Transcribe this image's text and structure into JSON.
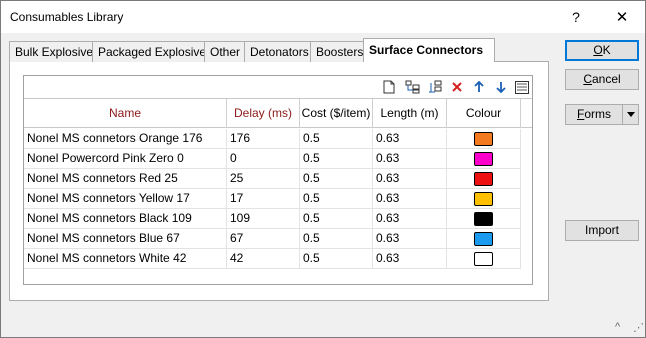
{
  "window": {
    "title": "Consumables Library",
    "help_label": "?",
    "close_label": "✕"
  },
  "tabs": [
    {
      "label": "Bulk Explosives",
      "active": false
    },
    {
      "label": "Packaged Explosives",
      "active": false
    },
    {
      "label": "Other",
      "active": false
    },
    {
      "label": "Detonators",
      "active": false
    },
    {
      "label": "Boosters",
      "active": false
    },
    {
      "label": "Surface Connectors",
      "active": true
    }
  ],
  "toolbar": {
    "icons": [
      "new-icon",
      "insert-row-icon",
      "append-row-icon",
      "delete-icon",
      "move-up-icon",
      "move-down-icon",
      "list-view-icon"
    ]
  },
  "table": {
    "columns": [
      "Name",
      "Delay (ms)",
      "Cost ($/item)",
      "Length (m)",
      "Colour"
    ],
    "rows": [
      {
        "name": "Nonel MS connetors Orange 176",
        "delay": "176",
        "cost": "0.5",
        "length": "0.63",
        "colour": "#f47a20"
      },
      {
        "name": "Nonel Powercord Pink Zero 0",
        "delay": "0",
        "cost": "0.5",
        "length": "0.63",
        "colour": "#ff00cc"
      },
      {
        "name": "Nonel MS connetors Red 25",
        "delay": "25",
        "cost": "0.5",
        "length": "0.63",
        "colour": "#ee1111"
      },
      {
        "name": "Nonel MS connetors Yellow 17",
        "delay": "17",
        "cost": "0.5",
        "length": "0.63",
        "colour": "#ffc000"
      },
      {
        "name": "Nonel MS connetors Black 109",
        "delay": "109",
        "cost": "0.5",
        "length": "0.63",
        "colour": "#000000"
      },
      {
        "name": "Nonel MS connetors Blue 67",
        "delay": "67",
        "cost": "0.5",
        "length": "0.63",
        "colour": "#1a9bef"
      },
      {
        "name": "Nonel MS connetors White 42",
        "delay": "42",
        "cost": "0.5",
        "length": "0.63",
        "colour": "#ffffff"
      }
    ]
  },
  "buttons": {
    "ok_underlined": "O",
    "ok_rest": "K",
    "cancel_underlined": "C",
    "cancel_rest": "ancel",
    "forms_underlined": "F",
    "forms_rest": "orms",
    "import": "Import"
  },
  "footer": {
    "collapse_glyph": "^",
    "resize_glyph": "⋰"
  },
  "colors": {
    "accent": "#0078d7",
    "header_red": "#8b1a1a"
  }
}
